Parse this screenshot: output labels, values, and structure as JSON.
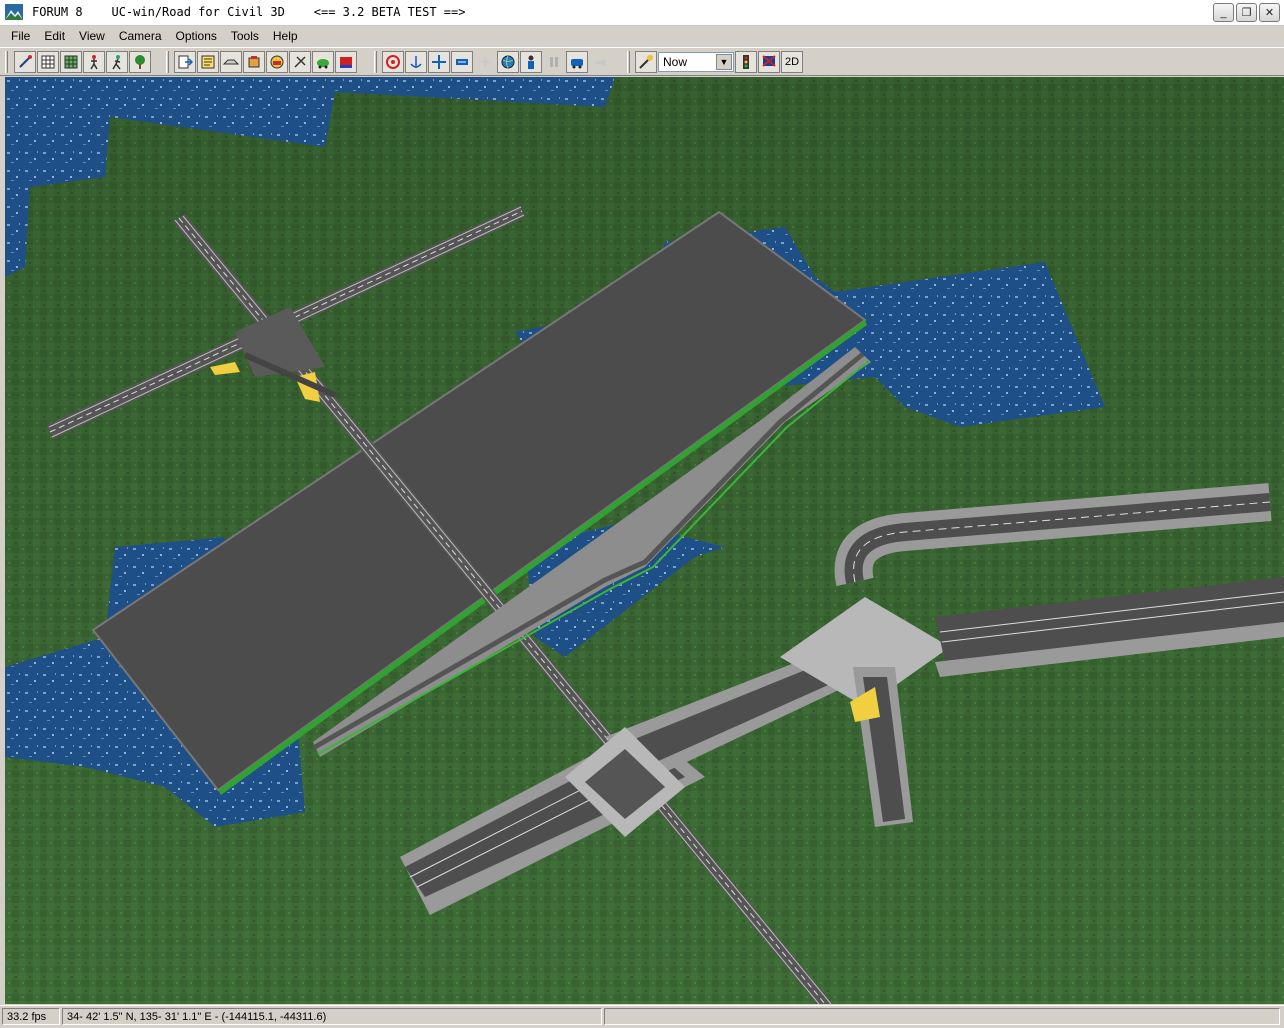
{
  "window": {
    "title": "FORUM 8    UC-win/Road for Civil 3D    <== 3.2 BETA TEST ==>",
    "controls": {
      "minimize": "_",
      "restore": "❐",
      "close": "✕"
    }
  },
  "menu": [
    "File",
    "Edit",
    "View",
    "Camera",
    "Options",
    "Tools",
    "Help"
  ],
  "toolbar": {
    "group1_icons": [
      "road-edit-icon",
      "road-grid-icon",
      "terrain-grid-icon",
      "pedestrian-icon",
      "walker-icon",
      "tree-icon"
    ],
    "group2_icons": [
      "export-icon",
      "road-list-icon",
      "cross-section-icon",
      "model-icon",
      "vehicle-icon",
      "traffic-icon",
      "car-icon",
      "flag-icon"
    ],
    "group3_icons": [
      "target-icon",
      "anchor-icon",
      "move-icon",
      "transport-icon",
      "fly-icon",
      "globe-icon",
      "person-icon",
      "pause-icon",
      "drive-icon",
      "plane-icon"
    ],
    "time_label": "Now",
    "twod_label": "2D"
  },
  "status": {
    "fps": "33.2 fps",
    "position": "34- 42' 1.5\" N, 135- 31' 1.1\" E  -  (-144115.1, -44311.6)"
  },
  "colors": {
    "grass": "#3c6b34",
    "water": "#1d4f86",
    "asphalt": "#555555",
    "sidewalk": "#a8a8a8"
  }
}
